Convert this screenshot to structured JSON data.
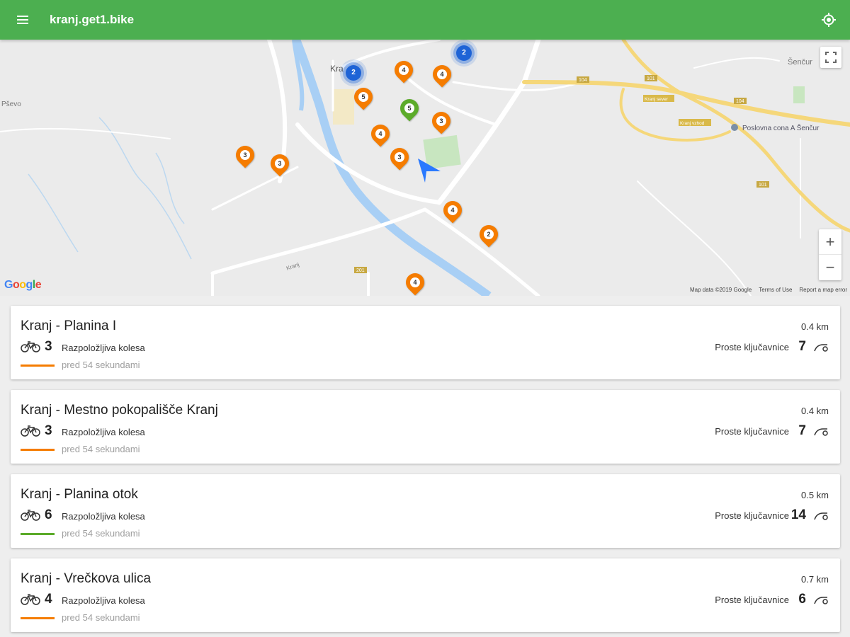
{
  "app": {
    "title": "kranj.get1.bike",
    "primary_color": "#4caf50",
    "menu_icon": "menu-icon",
    "locate_icon": "my-location-icon"
  },
  "map": {
    "labels": {
      "kranj": "Kra",
      "predvor": "Pševo",
      "sencur": "Šenčur",
      "poslovna": "Poslovna cona A Šenčur",
      "road_104": "104",
      "road_101": "101",
      "road_101b": "101",
      "road_104b": "104",
      "road_201": "201",
      "kranj_road": "Kranj",
      "kranj_sever": "Kranj sever",
      "kranj_vzhod": "Kranj vzhod"
    },
    "markers": [
      {
        "label": "4",
        "color": "#f57c00"
      },
      {
        "label": "4",
        "color": "#f57c00"
      },
      {
        "label": "5",
        "color": "#f57c00"
      },
      {
        "label": "5",
        "color": "#5cab2a"
      },
      {
        "label": "3",
        "color": "#f57c00"
      },
      {
        "label": "4",
        "color": "#f57c00"
      },
      {
        "label": "3",
        "color": "#f57c00"
      },
      {
        "label": "3",
        "color": "#f57c00"
      },
      {
        "label": "3",
        "color": "#f57c00"
      },
      {
        "label": "4",
        "color": "#f57c00"
      },
      {
        "label": "2",
        "color": "#f57c00"
      },
      {
        "label": "4",
        "color": "#f57c00"
      }
    ],
    "clusters": [
      {
        "label": "2"
      },
      {
        "label": "2"
      }
    ],
    "zoom_in": "+",
    "zoom_out": "−",
    "google_logo": "Google",
    "attribution": {
      "map_data": "Map data ©2019 Google",
      "terms": "Terms of Use",
      "report": "Report a map error"
    }
  },
  "stations": [
    {
      "name": "Kranj - Planina I",
      "bikes": "3",
      "bikes_label": "Razpoložljiva kolesa",
      "updated": "pred 54 sekundami",
      "distance": "0.4 km",
      "locks_label": "Proste ključavnice",
      "locks": "7",
      "status_color": "#f57c00"
    },
    {
      "name": "Kranj - Mestno pokopališče Kranj",
      "bikes": "3",
      "bikes_label": "Razpoložljiva kolesa",
      "updated": "pred 54 sekundami",
      "distance": "0.4 km",
      "locks_label": "Proste ključavnice",
      "locks": "7",
      "status_color": "#f57c00"
    },
    {
      "name": "Kranj - Planina otok",
      "bikes": "6",
      "bikes_label": "Razpoložljiva kolesa",
      "updated": "pred 54 sekundami",
      "distance": "0.5 km",
      "locks_label": "Proste ključavnice",
      "locks": "14",
      "status_color": "#5cab2a"
    },
    {
      "name": "Kranj - Vrečkova ulica",
      "bikes": "4",
      "bikes_label": "Razpoložljiva kolesa",
      "updated": "pred 54 sekundami",
      "distance": "0.7 km",
      "locks_label": "Proste ključavnice",
      "locks": "6",
      "status_color": "#f57c00"
    }
  ]
}
